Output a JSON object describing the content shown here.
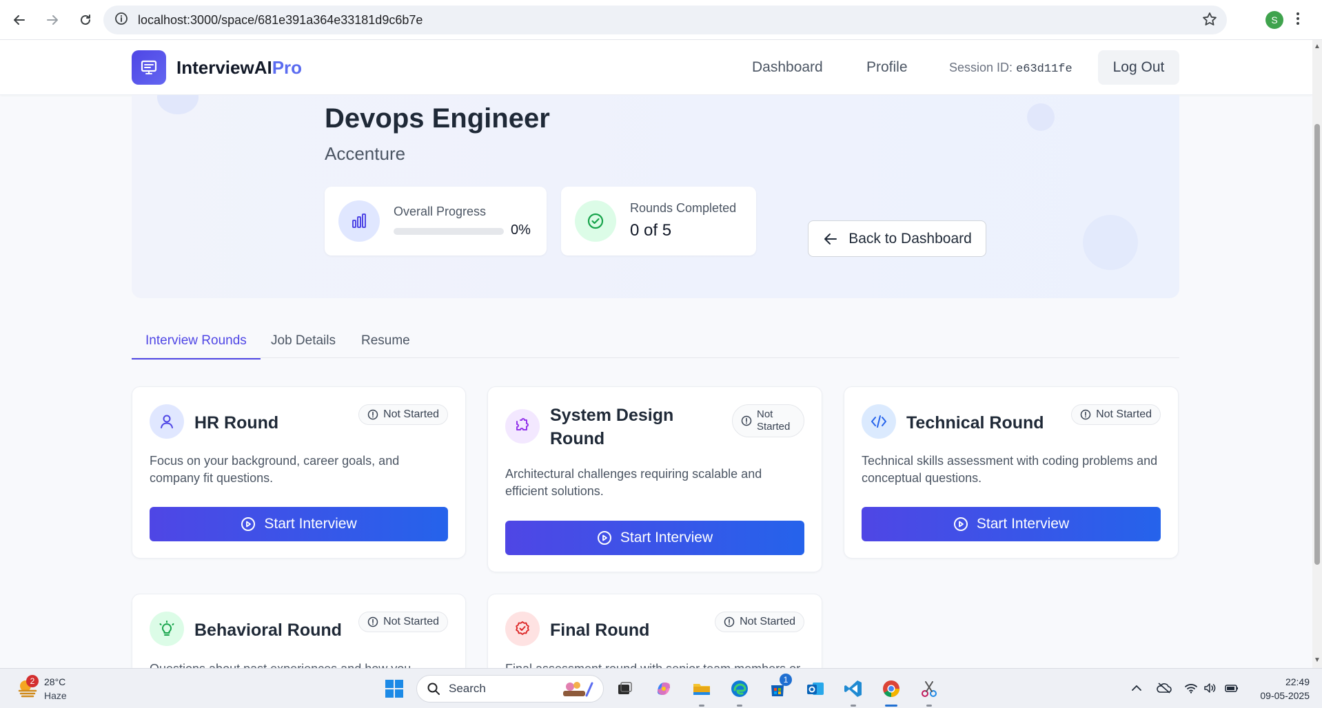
{
  "browser": {
    "url": "localhost:3000/space/681e391a364e33181d9c6b7e",
    "profile_initial": "S"
  },
  "header": {
    "logo_main": "InterviewAI",
    "logo_accent": "Pro",
    "nav_dashboard": "Dashboard",
    "nav_profile": "Profile",
    "session_label": "Session ID:",
    "session_id": "e63d11fe",
    "logout": "Log Out"
  },
  "hero": {
    "job_title": "Devops Engineer",
    "company": "Accenture",
    "progress_label": "Overall Progress",
    "progress_percent": "0%",
    "progress_value": 0,
    "rounds_label": "Rounds Completed",
    "rounds_value": "0 of 5",
    "back_button": "Back to Dashboard"
  },
  "tabs": [
    {
      "label": "Interview Rounds",
      "active": true
    },
    {
      "label": "Job Details",
      "active": false
    },
    {
      "label": "Resume",
      "active": false
    }
  ],
  "rounds": [
    {
      "title": "HR Round",
      "status": "Not Started",
      "description": "Focus on your background, career goals, and company fit questions.",
      "button": "Start Interview",
      "icon": "user-icon"
    },
    {
      "title": "System Design Round",
      "status": "Not Started",
      "description": "Architectural challenges requiring scalable and efficient solutions.",
      "button": "Start Interview",
      "icon": "puzzle-icon"
    },
    {
      "title": "Technical Round",
      "status": "Not Started",
      "description": "Technical skills assessment with coding problems and conceptual questions.",
      "button": "Start Interview",
      "icon": "code-icon"
    },
    {
      "title": "Behavioral Round",
      "status": "Not Started",
      "description": "Questions about past experiences and how you",
      "icon": "lightbulb-icon"
    },
    {
      "title": "Final Round",
      "status": "Not Started",
      "description": "Final assessment round with senior team members or",
      "icon": "badge-check-icon"
    }
  ],
  "taskbar": {
    "temperature": "28°C",
    "weather": "Haze",
    "weather_badge": "2",
    "search": "Search",
    "store_badge": "1",
    "time": "22:49",
    "date": "09-05-2025"
  },
  "colors": {
    "primary": "#4f46e5",
    "primary_end": "#2563eb",
    "hero_bg": "#eef2fd",
    "success": "#16a34a"
  }
}
